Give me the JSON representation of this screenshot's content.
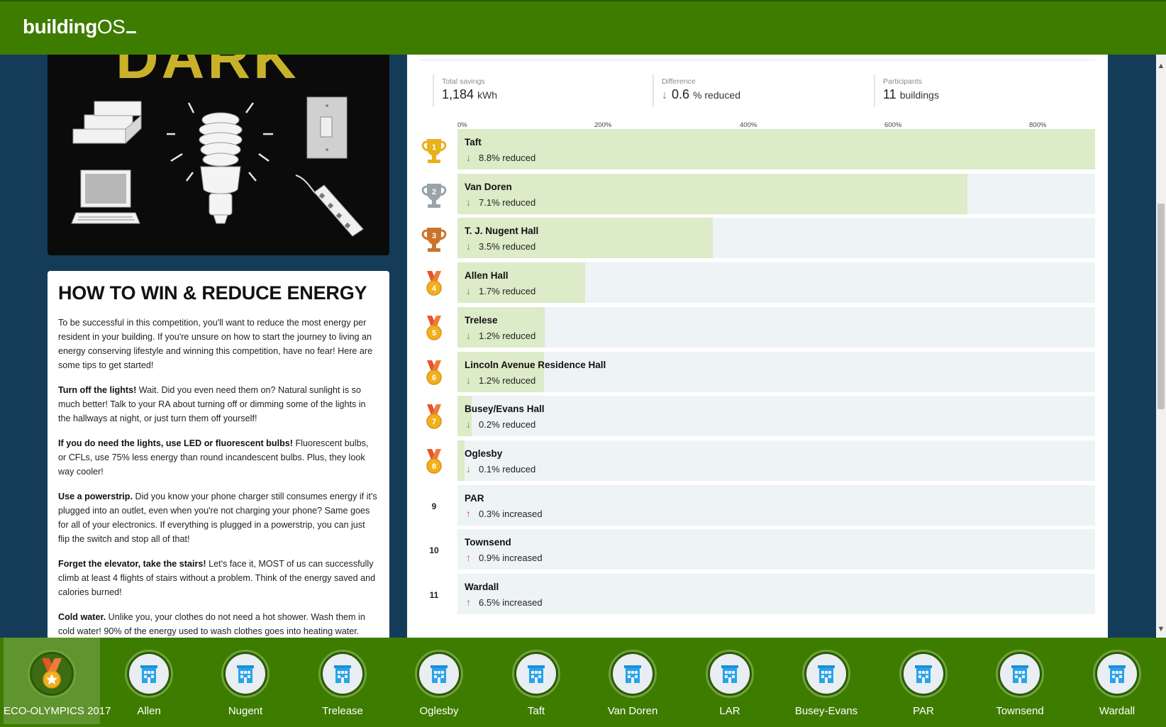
{
  "app": {
    "logo_bold": "building",
    "logo_light": "OS"
  },
  "image_card": {
    "headline_fragment": "DARK"
  },
  "tips": {
    "title": "HOW TO WIN & REDUCE ENERGY",
    "intro": "To be successful in this competition, you'll want to reduce the most energy per resident in your building. If you're unsure on how to start the journey to living an energy conserving lifestyle and winning this competition, have no fear! Here are some tips to get started!",
    "items": [
      {
        "head": "Turn off the lights!",
        "body": " Wait. Did you even need them on? Natural sunlight is so much better! Talk to your RA about turning off or dimming some of the lights in the hallways at night, or just turn them off yourself!"
      },
      {
        "head": "If you do need the lights, use LED or fluorescent bulbs!",
        "body": " Fluorescent bulbs, or CFLs, use 75% less energy than round incandescent bulbs. Plus, they look way cooler!"
      },
      {
        "head": "Use a powerstrip.",
        "body": " Did you know your phone charger still consumes energy if it's plugged into an outlet, even when you're not charging your phone? Same goes for all of your electronics. If everything is plugged in a powerstrip, you can just flip the switch and stop all of that!"
      },
      {
        "head": "Forget the elevator, take the stairs!",
        "body": " Let's face it, MOST of us can successfully climb at least 4 flights of stairs without a problem. Think of the energy saved and calories burned!"
      },
      {
        "head": "Cold water.",
        "body": " Unlike you, your clothes do not need a hot shower. Wash them in cold water! 90% of the energy used to wash clothes goes into heating water."
      }
    ]
  },
  "stats": {
    "total_savings": {
      "label": "Total savings",
      "value": "1,184",
      "unit": "kWh"
    },
    "difference": {
      "label": "Difference",
      "value": "0.6",
      "unit": "% reduced"
    },
    "participants": {
      "label": "Participants",
      "value": "11",
      "unit": "buildings"
    }
  },
  "axis_ticks": [
    "0%",
    "200%",
    "400%",
    "600%",
    "800%"
  ],
  "chart_data": {
    "type": "bar",
    "orientation": "horizontal",
    "categories": [
      "Taft",
      "Van Doren",
      "T. J. Nugent Hall",
      "Allen Hall",
      "Trelese",
      "Lincoln Avenue Residence Hall",
      "Busey/Evans Hall",
      "Oglesby",
      "PAR",
      "Townsend",
      "Wardall"
    ],
    "values": [
      8.8,
      7.1,
      3.5,
      1.7,
      1.2,
      1.2,
      0.2,
      0.1,
      -0.3,
      -0.9,
      -6.5
    ],
    "labels": [
      "8.8% reduced",
      "7.1% reduced",
      "3.5% reduced",
      "1.7% reduced",
      "1.2% reduced",
      "1.2% reduced",
      "0.2% reduced",
      "0.1% reduced",
      "0.3% increased",
      "0.9% increased",
      "6.5% increased"
    ],
    "directions": [
      "down",
      "down",
      "down",
      "down",
      "down",
      "down",
      "down",
      "down",
      "up",
      "up",
      "up"
    ],
    "ranks": [
      "1",
      "2",
      "3",
      "4",
      "5",
      "6",
      "7",
      "8",
      "9",
      "10",
      "11"
    ],
    "award": [
      "gold-trophy",
      "silver-trophy",
      "bronze-trophy",
      "medal",
      "medal",
      "medal",
      "medal",
      "medal",
      "",
      "",
      ""
    ],
    "fill_fraction": [
      1.0,
      0.8,
      0.4,
      0.2,
      0.137,
      0.136,
      0.022,
      0.011,
      0,
      0,
      0
    ],
    "colors": {
      "fill": "#dcebc8",
      "track": "#eef3f5",
      "down": "#5a9e1f",
      "up": "#e04a3b"
    }
  },
  "nav": {
    "items": [
      {
        "label": "ECO-OLYMPICS 2017",
        "icon": "medal-icon",
        "active": true
      },
      {
        "label": "Allen",
        "icon": "building-icon"
      },
      {
        "label": "Nugent",
        "icon": "building-icon"
      },
      {
        "label": "Trelease",
        "icon": "building-icon"
      },
      {
        "label": "Oglesby",
        "icon": "building-icon"
      },
      {
        "label": "Taft",
        "icon": "building-icon"
      },
      {
        "label": "Van Doren",
        "icon": "building-icon"
      },
      {
        "label": "LAR",
        "icon": "building-icon"
      },
      {
        "label": "Busey-Evans",
        "icon": "building-icon"
      },
      {
        "label": "PAR",
        "icon": "building-icon"
      },
      {
        "label": "Townsend",
        "icon": "building-icon"
      },
      {
        "label": "Wardall",
        "icon": "building-icon"
      }
    ]
  },
  "colors": {
    "brand_green": "#3e7c00",
    "background_navy": "#143c59"
  }
}
